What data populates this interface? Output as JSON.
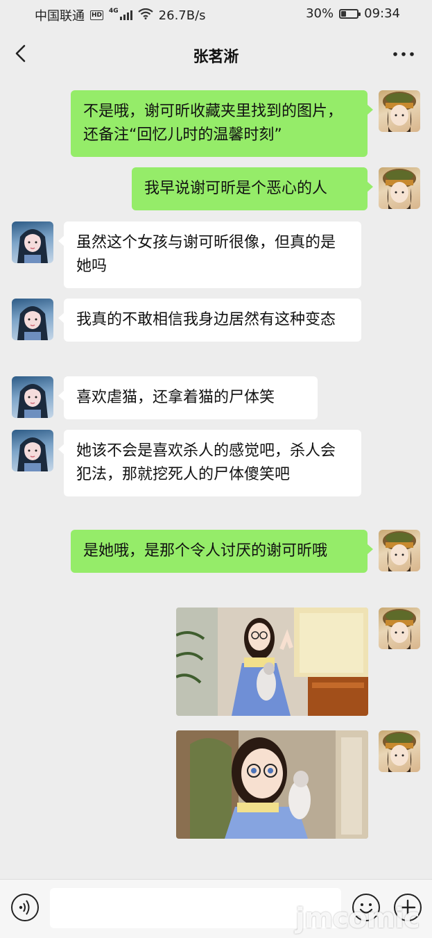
{
  "status_bar": {
    "carrier": "中国联通",
    "hd": "HD",
    "network": "4G",
    "speed": "26.7B/s",
    "battery_percent": "30%",
    "battery_level": 0.3,
    "time": "09:34"
  },
  "nav": {
    "title": "张茗淅",
    "back_icon": "chevron-left-icon",
    "more_icon": "more-dots-icon"
  },
  "messages": [
    {
      "sender": "me",
      "type": "text",
      "text": "不是哦，谢可昕收藏夹里找到的图片，还备注“回忆儿时的温馨时刻”"
    },
    {
      "sender": "me",
      "type": "text",
      "text": "我早说谢可昕是个恶心的人"
    },
    {
      "sender": "other",
      "type": "text",
      "text": "虽然这个女孩与谢可昕很像，但真的是她吗"
    },
    {
      "sender": "other",
      "type": "text",
      "text": "我真的不敢相信我身边居然有这种变态"
    },
    {
      "sender": "other",
      "type": "text",
      "text": "喜欢虐猫，还拿着猫的尸体笑"
    },
    {
      "sender": "other",
      "type": "text",
      "text": "她该不会是喜欢杀人的感觉吧，杀人会犯法，那就挖死人的尸体傻笑吧"
    },
    {
      "sender": "me",
      "type": "text",
      "text": "是她哦，是那个令人讨厌的谢可昕哦"
    },
    {
      "sender": "me",
      "type": "image"
    },
    {
      "sender": "me",
      "type": "image"
    }
  ],
  "input_bar": {
    "voice_icon": "voice-icon",
    "emoji_icon": "emoji-icon",
    "plus_icon": "plus-icon",
    "placeholder": ""
  },
  "watermark": "jmcomic",
  "colors": {
    "background": "#ededed",
    "bubble_me": "#95ec69",
    "bubble_other": "#ffffff"
  }
}
